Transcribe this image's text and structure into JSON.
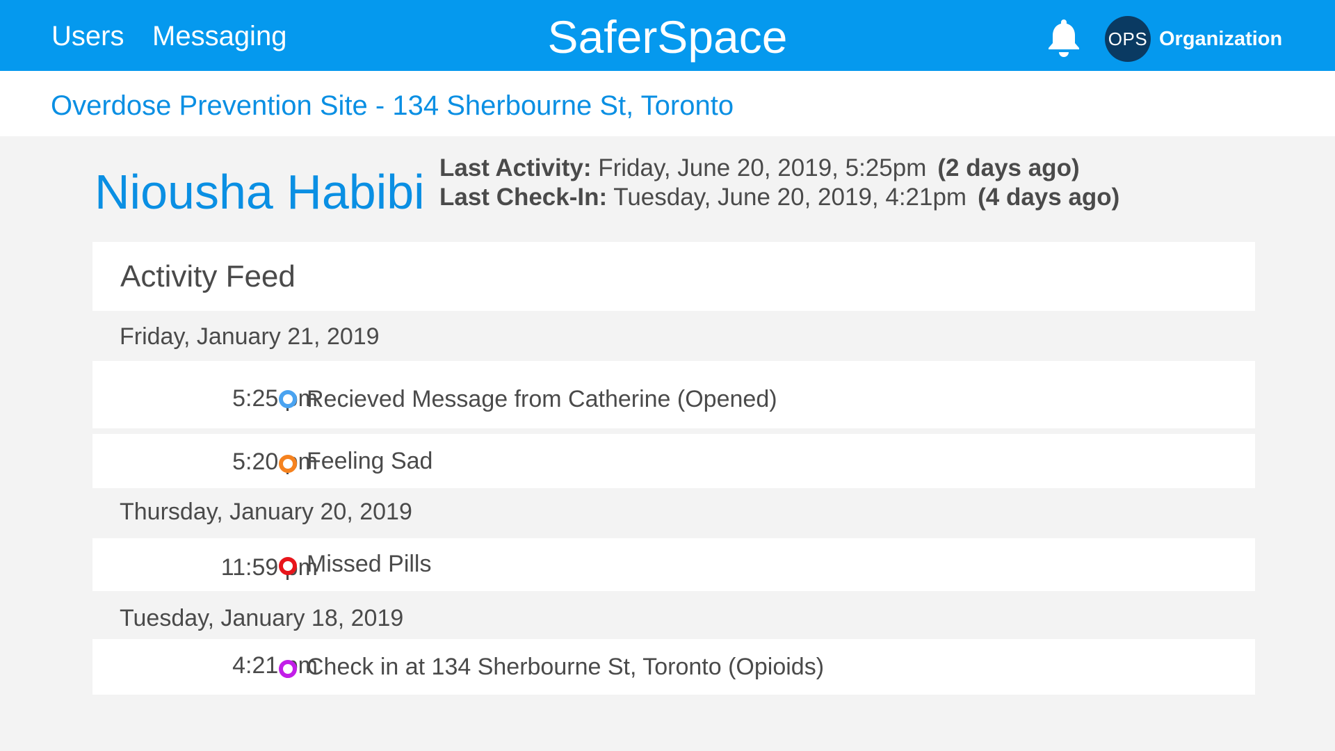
{
  "header": {
    "nav": [
      "Users",
      "Messaging"
    ],
    "brand": "SaferSpace",
    "avatar_text": "OPS",
    "org_label": "Organization",
    "bell_icon": "bell-icon"
  },
  "site": {
    "title": "Overdose Prevention Site - 134 Sherbourne St, Toronto"
  },
  "profile": {
    "name": "Niousha Habibi",
    "last_activity_label": "Last Activity:",
    "last_activity_value": "Friday, June 20, 2019, 5:25pm",
    "last_activity_ago": "(2 days ago)",
    "last_checkin_label": "Last Check-In:",
    "last_checkin_value": "Tuesday, June 20, 2019, 4:21pm",
    "last_checkin_ago": "(4 days ago)"
  },
  "feed": {
    "title": "Activity Feed",
    "groups": [
      {
        "date": "Friday, January 21, 2019",
        "items": [
          {
            "time": "5:25 pm",
            "text": "Recieved Message from Catherine (Opened)",
            "color": "#4aa3f0"
          },
          {
            "time": "5:20 pm",
            "text": "Feeling Sad",
            "color": "#f5821f"
          }
        ]
      },
      {
        "date": "Thursday, January 20, 2019",
        "items": [
          {
            "time": "11:59 pm",
            "text": "Missed Pills",
            "color": "#e8151b"
          }
        ]
      },
      {
        "date": "Tuesday, January 18, 2019",
        "items": [
          {
            "time": "4:21 pm",
            "text": "Check in at 134 Sherbourne St, Toronto (Opioids)",
            "color": "#c21ee8"
          }
        ]
      }
    ]
  },
  "colors": {
    "brand_blue": "#0599ee",
    "link_blue": "#0a8fe3",
    "avatar_bg": "#0a3a62",
    "page_bg": "#f3f3f3"
  }
}
